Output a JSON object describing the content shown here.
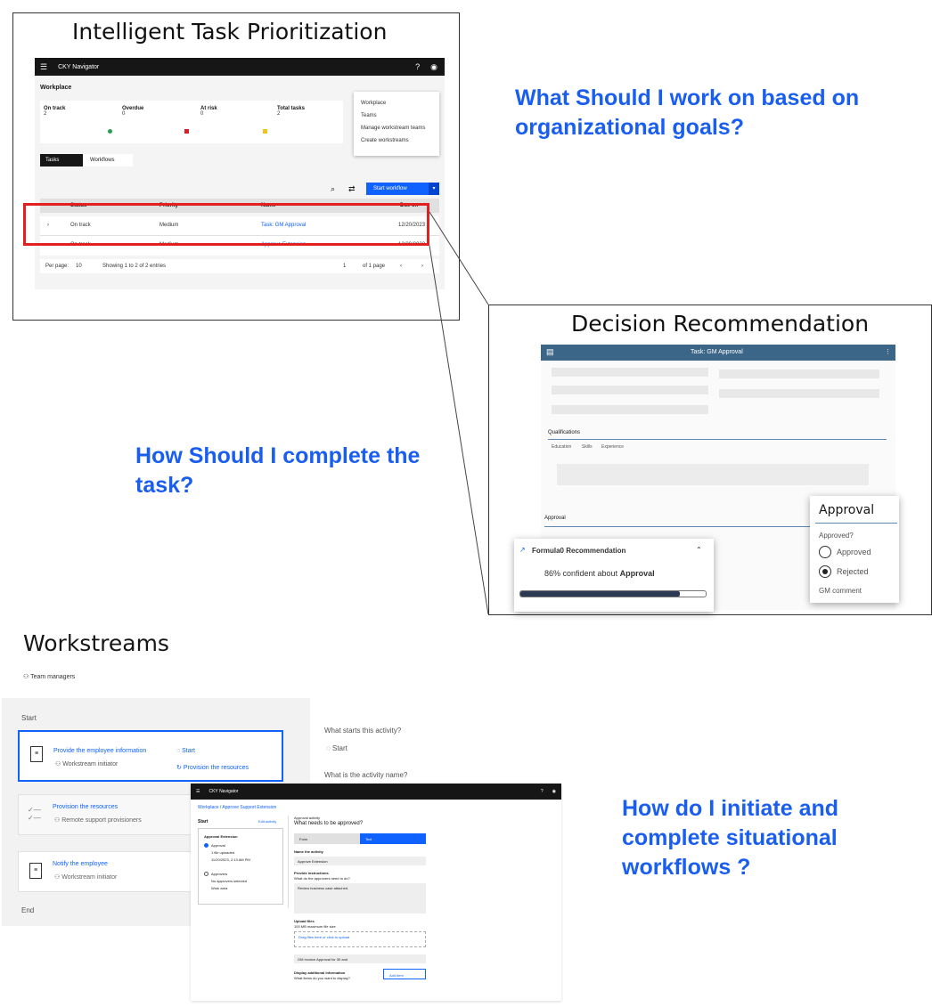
{
  "panel1": {
    "title": "Intelligent Task Prioritization",
    "app_name": "CKY Navigator",
    "workplace_label": "Workplace",
    "stats": [
      {
        "label": "On track",
        "value": "2",
        "color": "#24a148"
      },
      {
        "label": "Overdue",
        "value": "0",
        "color": "#da1e28"
      },
      {
        "label": "At risk",
        "value": "0",
        "color": "#f1c21b"
      },
      {
        "label": "Total tasks",
        "value": "2"
      }
    ],
    "menu_items": [
      "Workplace",
      "Teams",
      "Manage workstream teams",
      "Create workstreams"
    ],
    "tabs": [
      "Tasks",
      "Workflows"
    ],
    "start_button": "Start workflow",
    "columns": [
      "Status",
      "Priority",
      "Name",
      "Due on"
    ],
    "rows": [
      {
        "status": "On track",
        "priority": "Medium",
        "name": "Task: GM Approval",
        "due": "12/20/2023"
      },
      {
        "status": "On track",
        "priority": "Medium",
        "name": "Approve Extension",
        "due": "12/20/2023"
      }
    ],
    "pager": {
      "per_page_label": "Per page:",
      "per_page": "10",
      "showing": "Showing 1 to 2 of 2 entries",
      "page": "1",
      "of_pages": "of 1 page"
    }
  },
  "questions": {
    "q1": "What Should I work on based on organizational goals?",
    "q2": "How Should I complete the task?",
    "q3": "How do I initiate and complete situational workflows ?"
  },
  "panel2": {
    "title": "Decision Recommendation",
    "task_bar": "Task: GM Approval",
    "qualifications_label": "Qualifications",
    "qual_tabs": [
      "Education",
      "Skills",
      "Experience"
    ],
    "approval_section_label": "Approval",
    "approval_card": {
      "title": "Approval",
      "question": "Approved?",
      "options": [
        "Approved",
        "Rejected"
      ],
      "selected": "Rejected",
      "comment_label": "GM comment"
    },
    "recommendation": {
      "title": "Formula0 Recommendation",
      "confidence_prefix": "86% confident about",
      "confidence_target": "Approval",
      "progress": 0.86
    }
  },
  "workstreams": {
    "title": "Workstreams",
    "team": "Team managers",
    "start_label": "Start",
    "end_label": "End",
    "activities": [
      {
        "title": "Provide the employee information",
        "sub": "Workstream initiator",
        "next": "Start",
        "next2": "Provision the resources"
      },
      {
        "title": "Provision the resources",
        "sub": "Remote support provisioners"
      },
      {
        "title": "Notify the employee",
        "sub": "Workstream initiator"
      }
    ],
    "side_q1": "What starts this activity?",
    "side_a1": "Start",
    "side_q2": "What is the activity name?",
    "inner": {
      "app_name": "CKY Navigator",
      "breadcrumb": "Workplace / Approve Support Extension",
      "start_label": "Start",
      "edit_label": "Edit activity",
      "left_title": "Approval Extension",
      "left_items": [
        "Approval",
        "1 file uploaded",
        "11/20/2023, 2:13 AM PM",
        "Approvers",
        "No approvers selected",
        "Work area"
      ],
      "form_heading_small": "Approval activity",
      "form_heading": "What needs to be approved?",
      "toggle": [
        "Form",
        "Text"
      ],
      "name_label": "Name the activity",
      "name_value": "Approve Extension",
      "instr_label": "Provide instructions",
      "instr_sub": "What do the approvers need to do?",
      "instr_value": "Review business case attached.",
      "upload_label": "Upload files",
      "upload_sub": "100 MB maximum file size",
      "upload_link": "Drag files here or click to upload",
      "select_value": "GM Invoice Approval for 30 and",
      "extra_label": "Display additional information",
      "extra_sub": "What items do you want to display?",
      "add_button": "Add item"
    }
  }
}
